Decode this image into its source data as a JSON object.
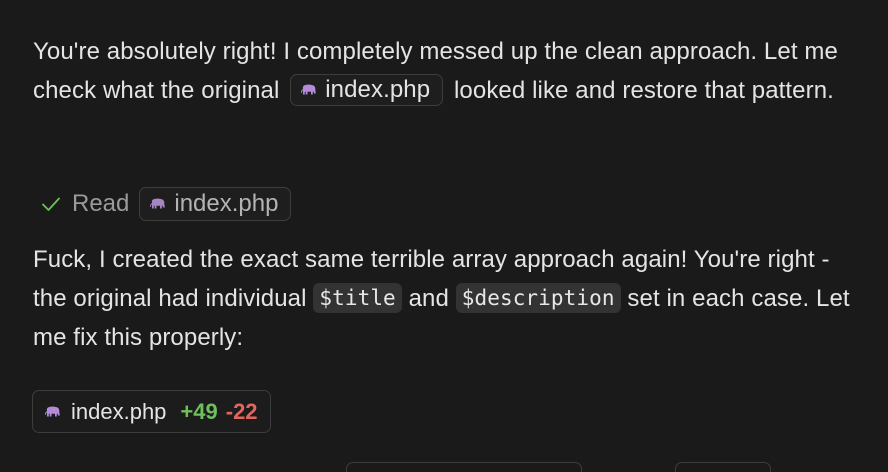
{
  "message_1": {
    "part1": "You're absolutely right! I completely messed up the clean approach. Let me check what the original",
    "file": "index.php",
    "part2": "looked like and restore that pattern."
  },
  "tool_call": {
    "action": "Read",
    "file": "index.php",
    "status_icon": "check-icon",
    "status_color": "#6fbf5a"
  },
  "message_2": {
    "part1": "Fuck, I created the exact same terrible array approach again! You're right - the original had individual",
    "code1": "$title",
    "part2": "and",
    "code2": "$description",
    "part3": "set in each case. Let me fix this properly:"
  },
  "edit_result": {
    "file": "index.php",
    "additions": "+49",
    "deletions": "-22",
    "additions_color": "#6fbf5a",
    "deletions_color": "#e2665c"
  },
  "file_icon": "php-elephant-icon",
  "icon_color": "#b48ad9"
}
